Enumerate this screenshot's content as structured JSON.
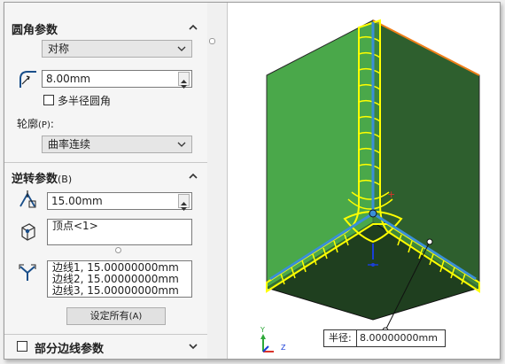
{
  "fillet_params": {
    "title": "圆角参数",
    "symmetry_select": "对称",
    "radius_value": "8.00mm",
    "multi_radius_label": "多半径圆角",
    "profile_label": "轮廓",
    "profile_shortcut": "(P)",
    "profile_colon": ":",
    "profile_select": "曲率连续"
  },
  "setback_params": {
    "title": "逆转参数",
    "title_shortcut": "(B)",
    "distance_value": "15.00mm",
    "vertex_items": [
      "顶点<1>"
    ],
    "edge_items": [
      "边线1, 15.00000000mm",
      "边线2, 15.00000000mm",
      "边线3, 15.00000000mm"
    ],
    "set_all_label": "设定所有",
    "set_all_shortcut": "(A)"
  },
  "partial_edge": {
    "label": "部分边线参数"
  },
  "viewport": {
    "dimension_label": "半径:",
    "dimension_value": "8.00000000mm",
    "triad_y": "Y",
    "triad_z": "Z"
  },
  "colors": {
    "face_light": "#4aa84a",
    "face_dark": "#2e5f2e",
    "face_bottom": "#1f3f1f",
    "fillet_edge": "#ffff00",
    "selected_edge": "#3a8fd8",
    "orange_edge": "#f07f1a"
  }
}
